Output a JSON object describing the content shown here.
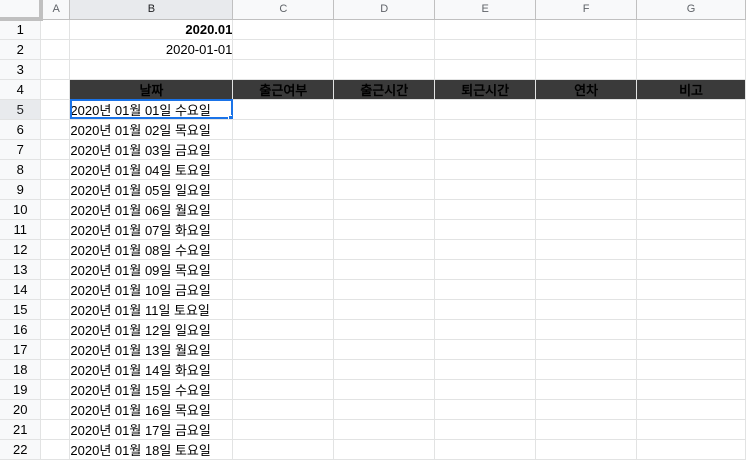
{
  "columns": [
    "A",
    "B",
    "C",
    "D",
    "E",
    "F",
    "G"
  ],
  "rows": [
    "1",
    "2",
    "3",
    "4",
    "5",
    "6",
    "7",
    "8",
    "9",
    "10",
    "11",
    "12",
    "13",
    "14",
    "15",
    "16",
    "17",
    "18",
    "19",
    "20",
    "21",
    "22"
  ],
  "cells": {
    "B1": "2020.01",
    "B2": "2020-01-01"
  },
  "table_headers": [
    "날짜",
    "출근여부",
    "출근시간",
    "퇴근시간",
    "연차",
    "비고"
  ],
  "dates": [
    "2020년 01월 01일 수요일",
    "2020년 01월 02일 목요일",
    "2020년 01월 03일 금요일",
    "2020년 01월 04일 토요일",
    "2020년 01월 05일 일요일",
    "2020년 01월 06일 월요일",
    "2020년 01월 07일 화요일",
    "2020년 01월 08일 수요일",
    "2020년 01월 09일 목요일",
    "2020년 01월 10일 금요일",
    "2020년 01월 11일 토요일",
    "2020년 01월 12일 일요일",
    "2020년 01월 13일 월요일",
    "2020년 01월 14일 화요일",
    "2020년 01월 15일 수요일",
    "2020년 01월 16일 목요일",
    "2020년 01월 17일 금요일",
    "2020년 01월 18일 토요일"
  ],
  "active_cell": "B5",
  "colors": {
    "header_dark": "#3a3a3a",
    "selection": "#1a73e8",
    "gridline": "#e2e3e3",
    "header_bg": "#f8f9fa"
  }
}
